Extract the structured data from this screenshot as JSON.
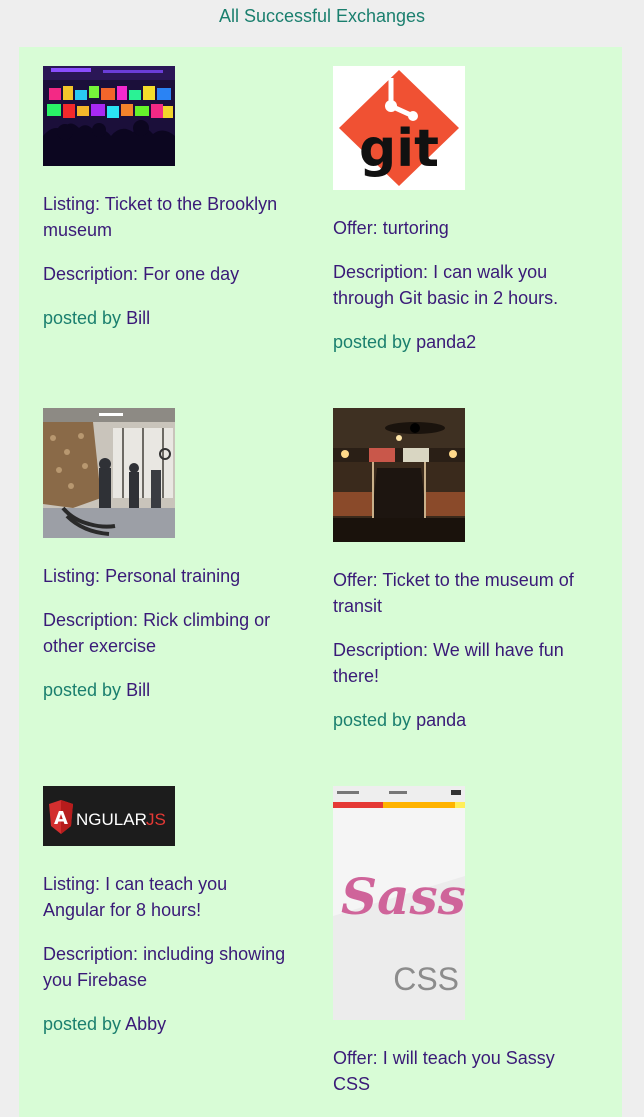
{
  "page": {
    "title": "All Successful Exchanges"
  },
  "exchanges": [
    {
      "listing": {
        "label": "Listing:",
        "text": "Ticket to the Brooklyn museum",
        "desc_label": "Description:",
        "desc": "For one day",
        "posted_label": "posted by",
        "poster": "Bill",
        "image": "museum-party-photo"
      },
      "offer": {
        "label": "Offer:",
        "text": "turtoring",
        "desc_label": "Description:",
        "desc": "I can walk you through Git basic in 2 hours.",
        "posted_label": "posted by",
        "poster": "panda2",
        "image": "git-logo",
        "logo_text": "git"
      }
    },
    {
      "listing": {
        "label": "Listing:",
        "text": "Personal training",
        "desc_label": "Description:",
        "desc": "Rick climbing or other exercise",
        "posted_label": "posted by",
        "poster": "Bill",
        "image": "climbing-gym-photo"
      },
      "offer": {
        "label": "Offer:",
        "text": "Ticket to the museum of transit",
        "desc_label": "Description:",
        "desc": "We will have fun there!",
        "posted_label": "posted by",
        "poster": "panda",
        "image": "subway-car-photo"
      }
    },
    {
      "listing": {
        "label": "Listing:",
        "text": "I can teach you Angular for 8 hours!",
        "desc_label": "Description:",
        "desc": "including showing you Firebase",
        "posted_label": "posted by",
        "poster": "Abby",
        "image": "angularjs-logo",
        "logo_a": "A",
        "logo_text": "NGULAR",
        "logo_js": "JS"
      },
      "offer": {
        "label": "Offer:",
        "text": "I will teach you Sassy CSS",
        "image": "sass-css-phone-screenshot",
        "logo_text": "Sass",
        "logo_css": "CSS"
      }
    }
  ]
}
